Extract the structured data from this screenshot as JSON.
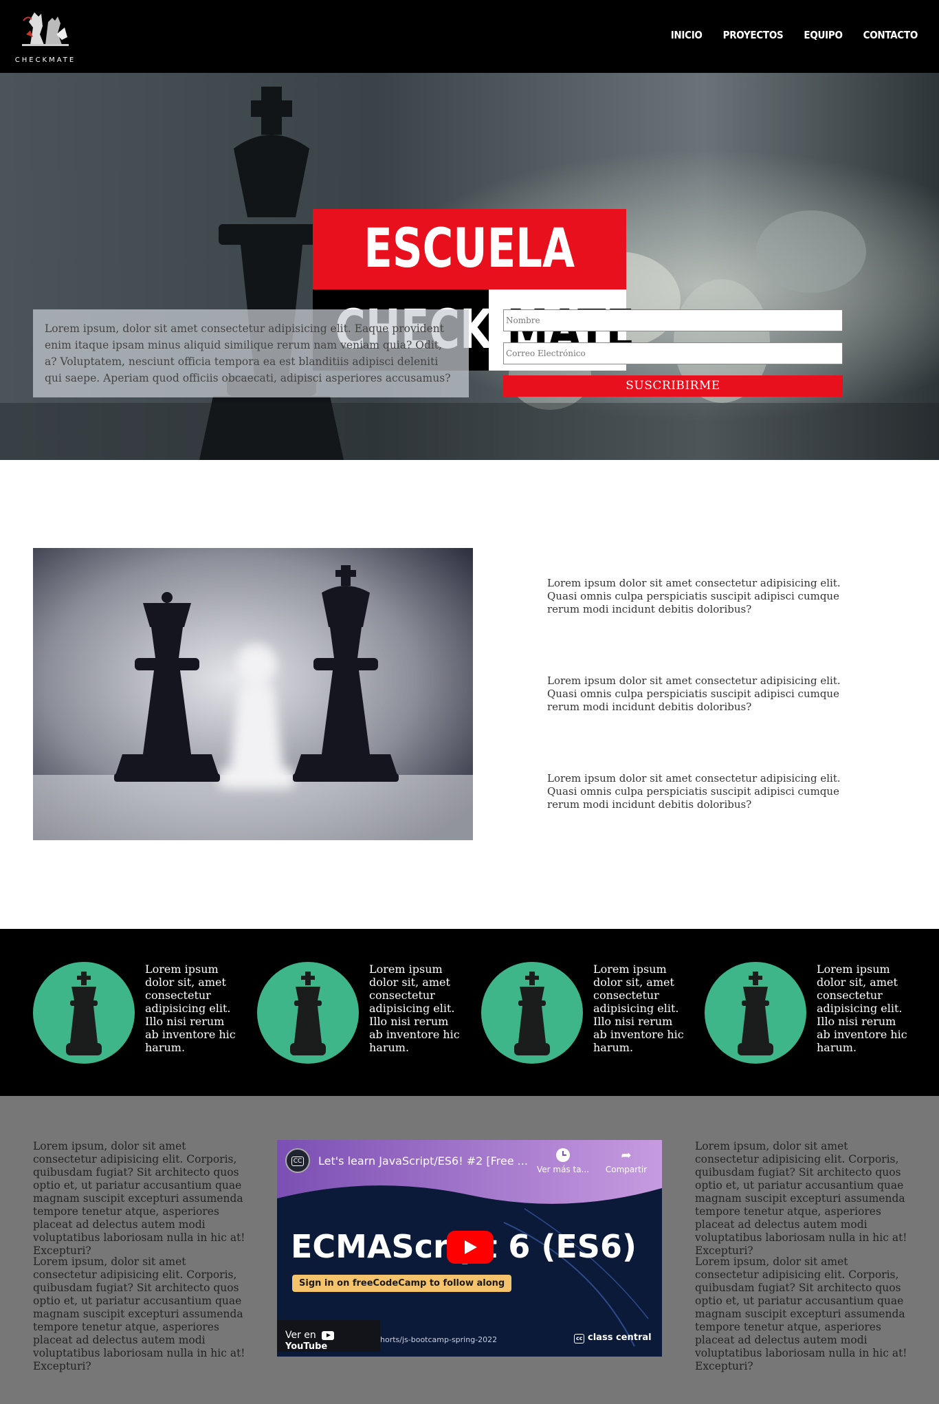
{
  "header": {
    "logo_text": "CHECKMATE",
    "nav": [
      "INICIO",
      "PROYECTOS",
      "EQUIPO",
      "CONTACTO"
    ]
  },
  "hero": {
    "title_top": "ESCUELA",
    "title_left": "CHECK",
    "title_right": "MATE",
    "description": "Lorem ipsum, dolor sit amet consectetur adipisicing elit. Eaque provident enim itaque ipsam minus aliquid similique rerum nam veniam quia? Odit, a? Voluptatem, nesciunt officia tempora ea est blanditiis adipisci deleniti qui saepe. Aperiam quod officiis obcaecati, adipisci asperiores accusamus?",
    "name_placeholder": "Nombre",
    "email_placeholder": "Correo Electrónico",
    "subscribe_label": "SUSCRIBIRME"
  },
  "about": {
    "paragraphs": [
      "Lorem ipsum dolor sit amet consectetur adipisicing elit. Quasi omnis culpa perspiciatis suscipit adipisci cumque rerum modi incidunt debitis doloribus?",
      "Lorem ipsum dolor sit amet consectetur adipisicing elit. Quasi omnis culpa perspiciatis suscipit adipisci cumque rerum modi incidunt debitis doloribus?",
      "Lorem ipsum dolor sit amet consectetur adipisicing elit. Quasi omnis culpa perspiciatis suscipit adipisci cumque rerum modi incidunt debitis doloribus?"
    ]
  },
  "features": [
    {
      "icon": "chess-king-icon",
      "text": "Lorem ipsum dolor sit, amet consectetur adipisicing elit. Illo nisi rerum ab inventore hic harum."
    },
    {
      "icon": "chess-king-icon",
      "text": "Lorem ipsum dolor sit, amet consectetur adipisicing elit. Illo nisi rerum ab inventore hic harum."
    },
    {
      "icon": "chess-king-icon",
      "text": "Lorem ipsum dolor sit, amet consectetur adipisicing elit. Illo nisi rerum ab inventore hic harum."
    },
    {
      "icon": "chess-king-icon",
      "text": "Lorem ipsum dolor sit, amet consectetur adipisicing elit. Illo nisi rerum ab inventore hic harum."
    }
  ],
  "bottom": {
    "left": [
      "Lorem ipsum, dolor sit amet consectetur adipisicing elit. Corporis, quibusdam fugiat? Sit architecto quos optio et, ut pariatur accusantium quae magnam suscipit excepturi assumenda tempore tenetur atque, asperiores placeat ad delectus autem modi voluptatibus laboriosam nulla in hic at! Excepturi?",
      "Lorem ipsum, dolor sit amet consectetur adipisicing elit. Corporis, quibusdam fugiat? Sit architecto quos optio et, ut pariatur accusantium quae magnam suscipit excepturi assumenda tempore tenetur atque, asperiores placeat ad delectus autem modi voluptatibus laboriosam nulla in hic at! Excepturi?"
    ],
    "right": [
      "Lorem ipsum, dolor sit amet consectetur adipisicing elit. Corporis, quibusdam fugiat? Sit architecto quos optio et, ut pariatur accusantium quae magnam suscipit excepturi assumenda tempore tenetur atque, asperiores placeat ad delectus autem modi voluptatibus laboriosam nulla in hic at! Excepturi?",
      "Lorem ipsum, dolor sit amet consectetur adipisicing elit. Corporis, quibusdam fugiat? Sit architecto quos optio et, ut pariatur accusantium quae magnam suscipit excepturi assumenda tempore tenetur atque, asperiores placeat ad delectus autem modi voluptatibus laboriosam nulla in hic at! Excepturi?"
    ],
    "video": {
      "title": "Let's learn JavaScript/ES6! #2 [Free ...",
      "watch_later": "Ver más ta...",
      "share": "Compartir",
      "headline": "ECMAScript 6 (ES6)",
      "signin": "Sign in on freeCodeCamp to follow along",
      "watch_on": "Ver en",
      "youtube": "YouTube",
      "url": "horts/js-bootcamp-spring-2022",
      "brand": "class central"
    }
  },
  "colors": {
    "accent": "#e8101c",
    "feature_circle": "#3fb58a",
    "header_bg": "#000000",
    "bottom_bg": "#777777"
  }
}
